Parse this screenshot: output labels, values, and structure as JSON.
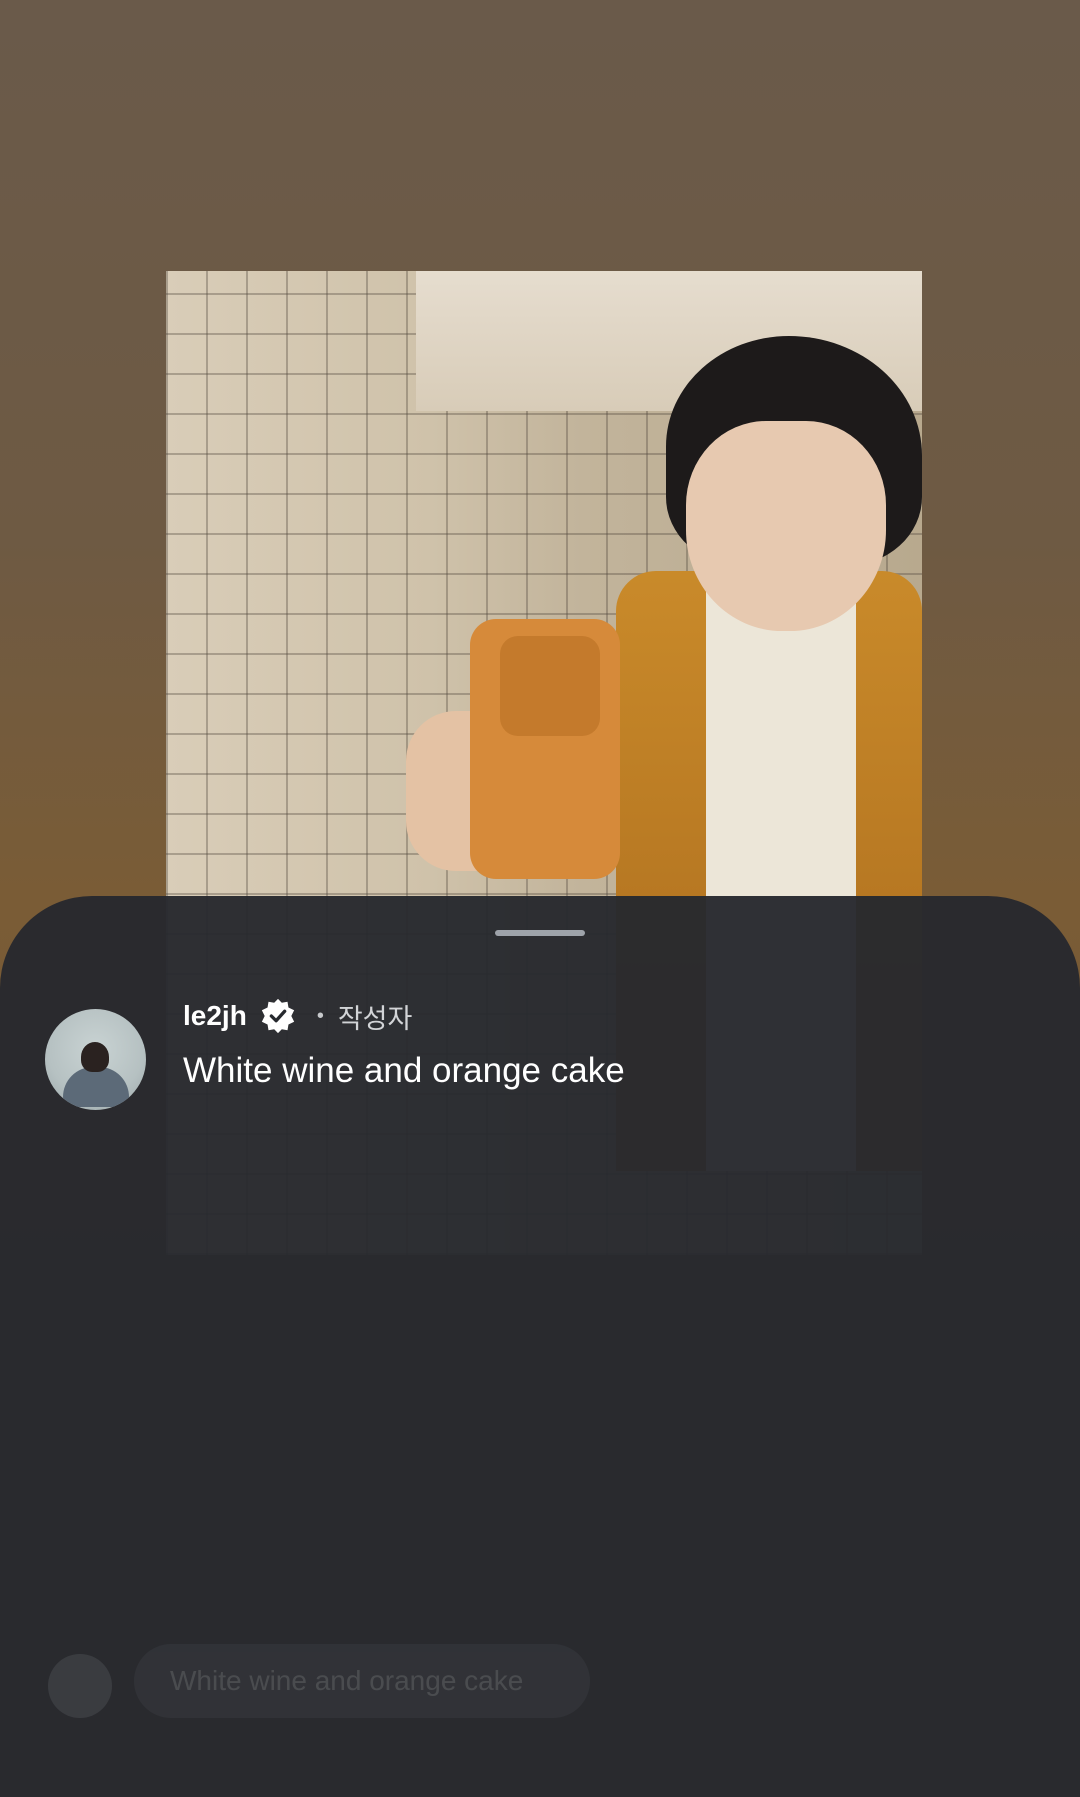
{
  "comment": {
    "username": "le2jh",
    "verified_icon": "verified-badge-icon",
    "separator": "•",
    "author_tag": "작성자",
    "text": "White wine and orange cake"
  },
  "reply_preview": {
    "text": "White wine and orange cake"
  },
  "colors": {
    "sheet": "#26292e",
    "text": "#ffffff",
    "muted": "#d2d4d7"
  }
}
